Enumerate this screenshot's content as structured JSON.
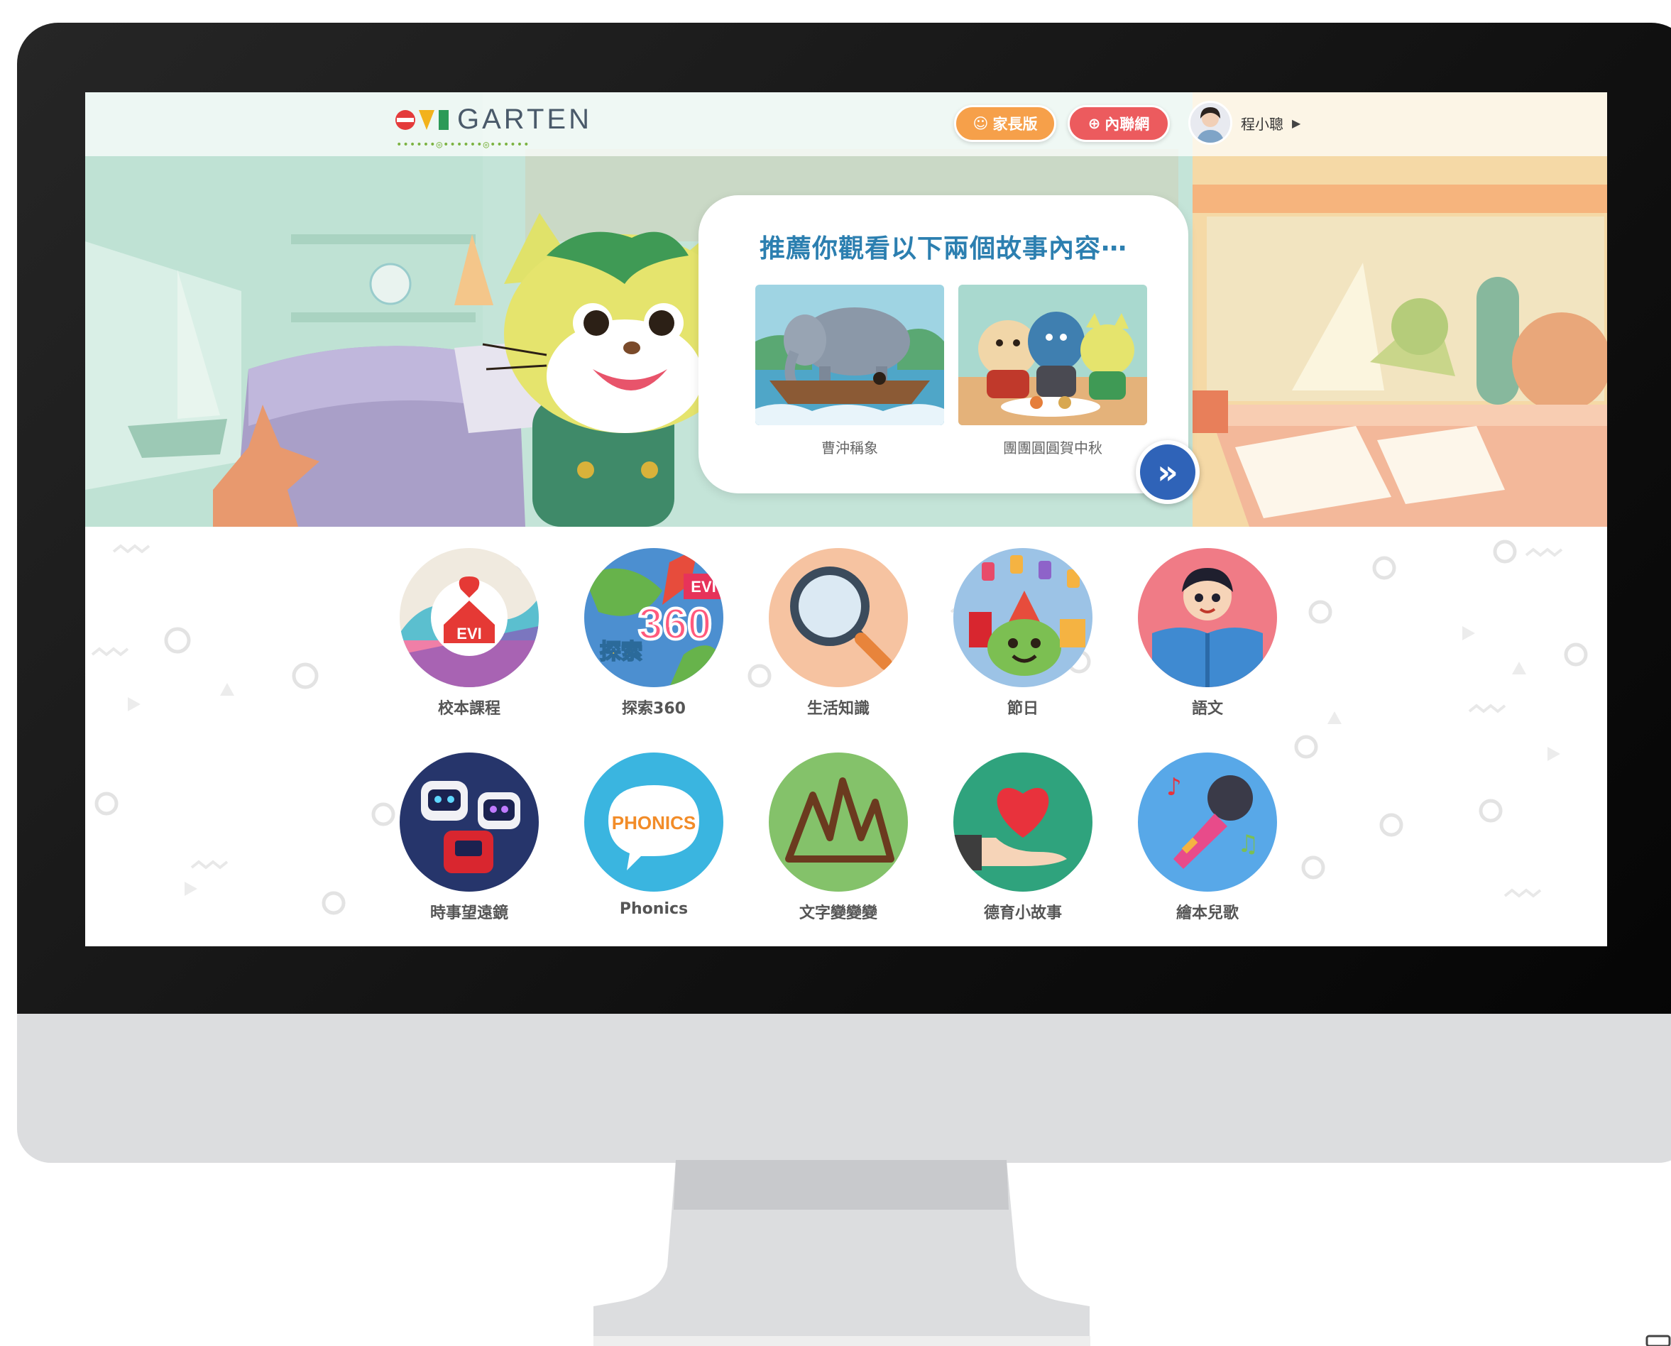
{
  "header": {
    "logo_text": "GARTEN",
    "parent_button": "家長版",
    "intranet_button": "內聯網",
    "user_name": "程小聰"
  },
  "recommend": {
    "title": "推薦你觀看以下兩個故事內容⋯",
    "stories": [
      {
        "caption": "曹沖稱象"
      },
      {
        "caption": "團團圓圓賀中秋"
      }
    ]
  },
  "categories": {
    "row1": [
      "校本課程",
      "探索360",
      "生活知識",
      "節日",
      "語文"
    ],
    "row2": [
      "時事望遠鏡",
      "Phonics",
      "文字變變變",
      "德育小故事",
      "繪本兒歌"
    ]
  },
  "icon_badges": {
    "evi": "EVI",
    "explore_num": "360",
    "explore_cn": "探索",
    "phonics": "PHONICS"
  },
  "colors": {
    "accent_blue": "#2c7fb0",
    "parent_orange": "#f6a04a",
    "intranet_red": "#ec5b5e",
    "next_blue": "#2f63b8"
  }
}
